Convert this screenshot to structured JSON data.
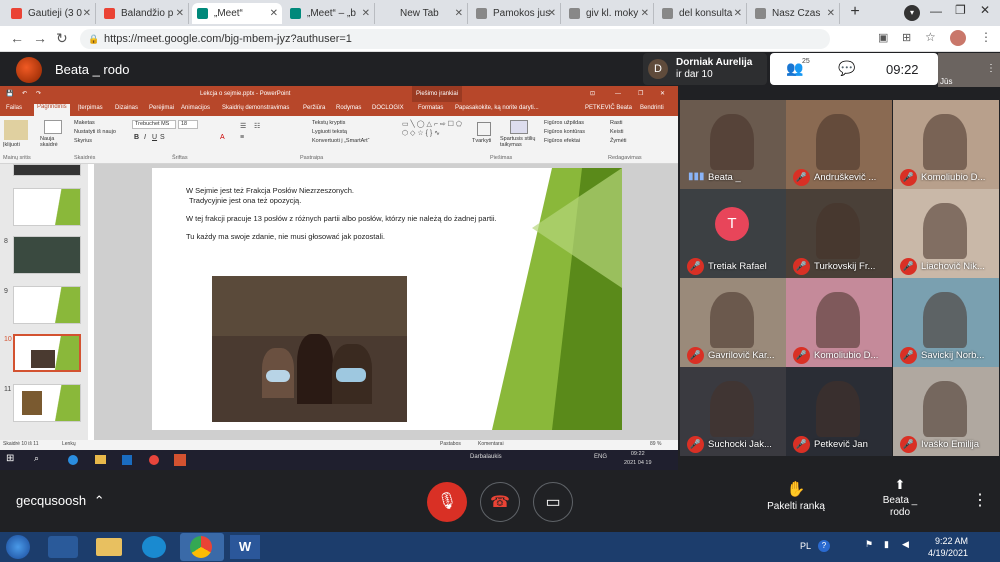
{
  "tabs": [
    {
      "title": "Gautieji (3 0",
      "color": "#ea4335",
      "icon": "gmail-icon"
    },
    {
      "title": "Balandžio p",
      "color": "#ea4335",
      "icon": "gmail-icon"
    },
    {
      "title": "„Meet“",
      "color": "#00897b",
      "icon": "meet-icon",
      "active": true
    },
    {
      "title": "„Meet“ – „b",
      "color": "#00897b",
      "icon": "meet-icon"
    },
    {
      "title": "New Tab",
      "color": "",
      "icon": ""
    },
    {
      "title": "Pamokos jus",
      "color": "#888",
      "icon": "globe-icon"
    },
    {
      "title": "giv kl. moky",
      "color": "#888",
      "icon": "globe-icon"
    },
    {
      "title": "del konsulta",
      "color": "#888",
      "icon": "globe-icon"
    },
    {
      "title": "Nasz Czas",
      "color": "#888",
      "icon": "globe-icon"
    }
  ],
  "url": "https://meet.google.com/bjg-mbem-jyz?authuser=1",
  "presenter": {
    "name": "Beata _ rodo"
  },
  "pinned": {
    "initial": "D",
    "name": "Dorniak Aurelija",
    "sub": "ir dar 10"
  },
  "people_count": "25",
  "clock": "09:22",
  "self_label": "Jūs",
  "ppt": {
    "title": "Lekcja o sejmie.pptx - PowerPoint",
    "context": "Piešimo įrankiai",
    "tabs": [
      "Failas",
      "Pagrindinis",
      "Įterpimas",
      "Dizainas",
      "Perėjimai",
      "Animacijos",
      "Skaidrių demonstravimas",
      "Peržiūra",
      "Rodymas",
      "DOCLOGIX",
      "Formatas"
    ],
    "tell_me": "Papasakokite, ką norite daryti...",
    "user": "PETKEVIČ Beata",
    "share": "Bendrinti",
    "groups": [
      "Mainų sritis",
      "Skaidrės",
      "Šriftas",
      "Pastraipa",
      "Piešimas",
      "Redagavimas"
    ],
    "ribbon_items": [
      "Įklijuoti",
      "Nauja skaidrė",
      "Maketas",
      "Nustatyti iš naujo",
      "Skyrius",
      "Tekstų kryptis",
      "Lygiuoti tekstą",
      "Konvertuoti į „SmartArt“",
      "Tvarkyti",
      "Spartusis stilių taikymas",
      "Figūros užpildas",
      "Figūros kontūras",
      "Figūros efektai",
      "Rasti",
      "Keisti",
      "Žymėti"
    ],
    "font": "Trebuchet MS",
    "fontsize": "18",
    "slide_nums": [
      "8",
      "9",
      "10",
      "11"
    ],
    "slide_text": [
      "W Sejmie jest też Frakcja Posłów Niezrzeszonych.",
      "Tradycyjnie jest ona też opozycją.",
      "W tej frakcji pracuje 13 posłów z różnych partii albo posłów, którzy nie należą do żadnej partii.",
      "Tu każdy ma swoje zdanie, nie musi głosować jak pozostali."
    ],
    "status": "Skaidrė 10 iš 11",
    "lang": "Lenkų",
    "notes": "Pastabos",
    "comments": "Komentarai",
    "zoom": "89 %",
    "task_time": "09:22",
    "task_date": "2021 04 19",
    "task_desk": "Darbalaukis",
    "task_lang": "ENG"
  },
  "participants": [
    {
      "name": "Beata _",
      "speaking": true,
      "bg": "#6a5a4e"
    },
    {
      "name": "Andruškevič ...",
      "bg": "#8a6a52"
    },
    {
      "name": "Komoliubio D...",
      "bg": "#b8a08c"
    },
    {
      "name": "Tretiak Rafael",
      "avatar": "T",
      "bg": "#3c4043"
    },
    {
      "name": "Turkovskij Fr...",
      "bg": "#4a4038"
    },
    {
      "name": "Liachovič Nik...",
      "bg": "#c9b8a8"
    },
    {
      "name": "Gavrilovič Kar...",
      "bg": "#9a8a7a"
    },
    {
      "name": "Komoliubio D...",
      "bg": "#c58a9a"
    },
    {
      "name": "Savickij Norb...",
      "bg": "#7aa0b0"
    },
    {
      "name": "Suchocki Jak...",
      "bg": "#3a3a40"
    },
    {
      "name": "Petkevič Jan",
      "bg": "#2a2d35"
    },
    {
      "name": "Ivaško Emilija",
      "bg": "#b0a8a0"
    }
  ],
  "bottom": {
    "code": "gecqusoosh",
    "raise_hand": "Pakelti ranką",
    "presenting": "Beata _ rodo"
  },
  "win": {
    "lang": "PL",
    "time": "9:22 AM",
    "date": "4/19/2021"
  }
}
